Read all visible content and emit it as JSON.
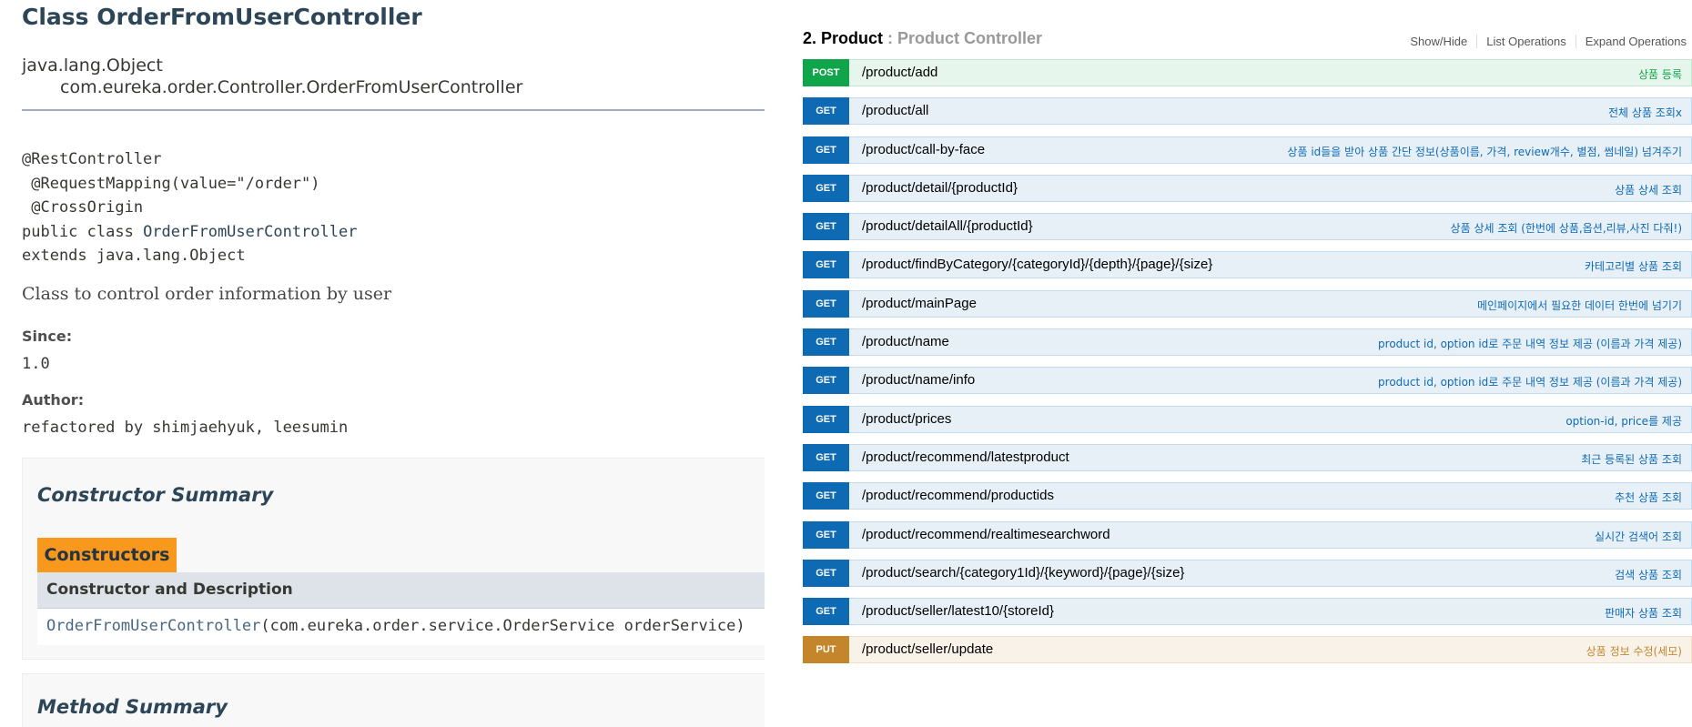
{
  "javadoc": {
    "title": "Class OrderFromUserController",
    "inheritance": {
      "parent": "java.lang.Object",
      "child": "com.eureka.order.Controller.OrderFromUserController"
    },
    "annotations": {
      "line1": "@RestController",
      "line2": " @RequestMapping(value=\"/order\")",
      "line3": " @CrossOrigin",
      "decl_prefix": "public class ",
      "decl_name": "OrderFromUserController",
      "line5": "extends java.lang.Object"
    },
    "description": "Class to control order information by user",
    "since_label": "Since:",
    "since_value": "1.0",
    "author_label": "Author:",
    "author_value": "refactored by shimjaehyuk, leesumin",
    "constructor_summary": {
      "heading": "Constructor Summary",
      "tab_label": "Constructors",
      "column_header": "Constructor and Description",
      "signature_link": "OrderFromUserController",
      "signature_params": "(com.eureka.order.service.OrderService orderService)"
    },
    "method_summary": {
      "heading": "Method Summary"
    }
  },
  "swagger": {
    "section_number": "2. Product",
    "section_separator": " : ",
    "section_name": "Product Controller",
    "links": {
      "show_hide": "Show/Hide",
      "list_operations": "List Operations",
      "expand_operations": "Expand Operations"
    },
    "operations": [
      {
        "method": "POST",
        "path": "/product/add",
        "summary": "상품 등록"
      },
      {
        "method": "GET",
        "path": "/product/all",
        "summary": "전체 상품 조회x"
      },
      {
        "method": "GET",
        "path": "/product/call-by-face",
        "summary": "상품 id들을 받아 상품 간단 정보(상품이름, 가격, review개수, 별점, 썸네일) 넘겨주기"
      },
      {
        "method": "GET",
        "path": "/product/detail/{productId}",
        "summary": "상품 상세 조회"
      },
      {
        "method": "GET",
        "path": "/product/detailAll/{productId}",
        "summary": "상품 상세 조회 (한번에 상품,옵션,리뷰,사진 다줘!)"
      },
      {
        "method": "GET",
        "path": "/product/findByCategory/{categoryId}/{depth}/{page}/{size}",
        "summary": "카테고리별 상품 조회"
      },
      {
        "method": "GET",
        "path": "/product/mainPage",
        "summary": "메인페이지에서 필요한 데이터 한번에 넘기기"
      },
      {
        "method": "GET",
        "path": "/product/name",
        "summary": "product id, option id로 주문 내역 정보 제공 (이름과 가격 제공)"
      },
      {
        "method": "GET",
        "path": "/product/name/info",
        "summary": "product id, option id로 주문 내역 정보 제공 (이름과 가격 제공)"
      },
      {
        "method": "GET",
        "path": "/product/prices",
        "summary": "option-id, price를 제공"
      },
      {
        "method": "GET",
        "path": "/product/recommend/latestproduct",
        "summary": "최근 등록된 상품 조회"
      },
      {
        "method": "GET",
        "path": "/product/recommend/productids",
        "summary": "추천 상품 조회"
      },
      {
        "method": "GET",
        "path": "/product/recommend/realtimesearchword",
        "summary": "실시간 검색어 조회"
      },
      {
        "method": "GET",
        "path": "/product/search/{category1Id}/{keyword}/{page}/{size}",
        "summary": "검색 상품 조회"
      },
      {
        "method": "GET",
        "path": "/product/seller/latest10/{storeId}",
        "summary": "판매자 상품 조회"
      },
      {
        "method": "PUT",
        "path": "/product/seller/update",
        "summary": "상품 정보 수정(세모)"
      }
    ]
  },
  "colors": {
    "get": "#0f6ab4",
    "post": "#10a54a",
    "put": "#c5862b",
    "javadoc_tab": "#f8981d"
  }
}
